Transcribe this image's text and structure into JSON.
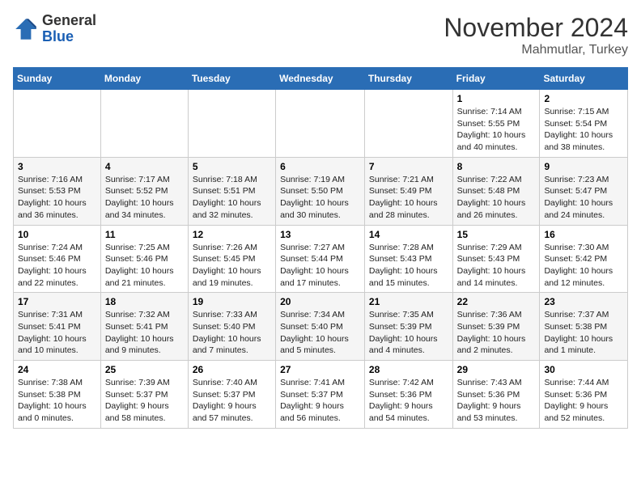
{
  "logo": {
    "general": "General",
    "blue": "Blue"
  },
  "header": {
    "month": "November 2024",
    "location": "Mahmutlar, Turkey"
  },
  "weekdays": [
    "Sunday",
    "Monday",
    "Tuesday",
    "Wednesday",
    "Thursday",
    "Friday",
    "Saturday"
  ],
  "weeks": [
    [
      {
        "day": "",
        "info": ""
      },
      {
        "day": "",
        "info": ""
      },
      {
        "day": "",
        "info": ""
      },
      {
        "day": "",
        "info": ""
      },
      {
        "day": "",
        "info": ""
      },
      {
        "day": "1",
        "info": "Sunrise: 7:14 AM\nSunset: 5:55 PM\nDaylight: 10 hours and 40 minutes."
      },
      {
        "day": "2",
        "info": "Sunrise: 7:15 AM\nSunset: 5:54 PM\nDaylight: 10 hours and 38 minutes."
      }
    ],
    [
      {
        "day": "3",
        "info": "Sunrise: 7:16 AM\nSunset: 5:53 PM\nDaylight: 10 hours and 36 minutes."
      },
      {
        "day": "4",
        "info": "Sunrise: 7:17 AM\nSunset: 5:52 PM\nDaylight: 10 hours and 34 minutes."
      },
      {
        "day": "5",
        "info": "Sunrise: 7:18 AM\nSunset: 5:51 PM\nDaylight: 10 hours and 32 minutes."
      },
      {
        "day": "6",
        "info": "Sunrise: 7:19 AM\nSunset: 5:50 PM\nDaylight: 10 hours and 30 minutes."
      },
      {
        "day": "7",
        "info": "Sunrise: 7:21 AM\nSunset: 5:49 PM\nDaylight: 10 hours and 28 minutes."
      },
      {
        "day": "8",
        "info": "Sunrise: 7:22 AM\nSunset: 5:48 PM\nDaylight: 10 hours and 26 minutes."
      },
      {
        "day": "9",
        "info": "Sunrise: 7:23 AM\nSunset: 5:47 PM\nDaylight: 10 hours and 24 minutes."
      }
    ],
    [
      {
        "day": "10",
        "info": "Sunrise: 7:24 AM\nSunset: 5:46 PM\nDaylight: 10 hours and 22 minutes."
      },
      {
        "day": "11",
        "info": "Sunrise: 7:25 AM\nSunset: 5:46 PM\nDaylight: 10 hours and 21 minutes."
      },
      {
        "day": "12",
        "info": "Sunrise: 7:26 AM\nSunset: 5:45 PM\nDaylight: 10 hours and 19 minutes."
      },
      {
        "day": "13",
        "info": "Sunrise: 7:27 AM\nSunset: 5:44 PM\nDaylight: 10 hours and 17 minutes."
      },
      {
        "day": "14",
        "info": "Sunrise: 7:28 AM\nSunset: 5:43 PM\nDaylight: 10 hours and 15 minutes."
      },
      {
        "day": "15",
        "info": "Sunrise: 7:29 AM\nSunset: 5:43 PM\nDaylight: 10 hours and 14 minutes."
      },
      {
        "day": "16",
        "info": "Sunrise: 7:30 AM\nSunset: 5:42 PM\nDaylight: 10 hours and 12 minutes."
      }
    ],
    [
      {
        "day": "17",
        "info": "Sunrise: 7:31 AM\nSunset: 5:41 PM\nDaylight: 10 hours and 10 minutes."
      },
      {
        "day": "18",
        "info": "Sunrise: 7:32 AM\nSunset: 5:41 PM\nDaylight: 10 hours and 9 minutes."
      },
      {
        "day": "19",
        "info": "Sunrise: 7:33 AM\nSunset: 5:40 PM\nDaylight: 10 hours and 7 minutes."
      },
      {
        "day": "20",
        "info": "Sunrise: 7:34 AM\nSunset: 5:40 PM\nDaylight: 10 hours and 5 minutes."
      },
      {
        "day": "21",
        "info": "Sunrise: 7:35 AM\nSunset: 5:39 PM\nDaylight: 10 hours and 4 minutes."
      },
      {
        "day": "22",
        "info": "Sunrise: 7:36 AM\nSunset: 5:39 PM\nDaylight: 10 hours and 2 minutes."
      },
      {
        "day": "23",
        "info": "Sunrise: 7:37 AM\nSunset: 5:38 PM\nDaylight: 10 hours and 1 minute."
      }
    ],
    [
      {
        "day": "24",
        "info": "Sunrise: 7:38 AM\nSunset: 5:38 PM\nDaylight: 10 hours and 0 minutes."
      },
      {
        "day": "25",
        "info": "Sunrise: 7:39 AM\nSunset: 5:37 PM\nDaylight: 9 hours and 58 minutes."
      },
      {
        "day": "26",
        "info": "Sunrise: 7:40 AM\nSunset: 5:37 PM\nDaylight: 9 hours and 57 minutes."
      },
      {
        "day": "27",
        "info": "Sunrise: 7:41 AM\nSunset: 5:37 PM\nDaylight: 9 hours and 56 minutes."
      },
      {
        "day": "28",
        "info": "Sunrise: 7:42 AM\nSunset: 5:36 PM\nDaylight: 9 hours and 54 minutes."
      },
      {
        "day": "29",
        "info": "Sunrise: 7:43 AM\nSunset: 5:36 PM\nDaylight: 9 hours and 53 minutes."
      },
      {
        "day": "30",
        "info": "Sunrise: 7:44 AM\nSunset: 5:36 PM\nDaylight: 9 hours and 52 minutes."
      }
    ]
  ]
}
